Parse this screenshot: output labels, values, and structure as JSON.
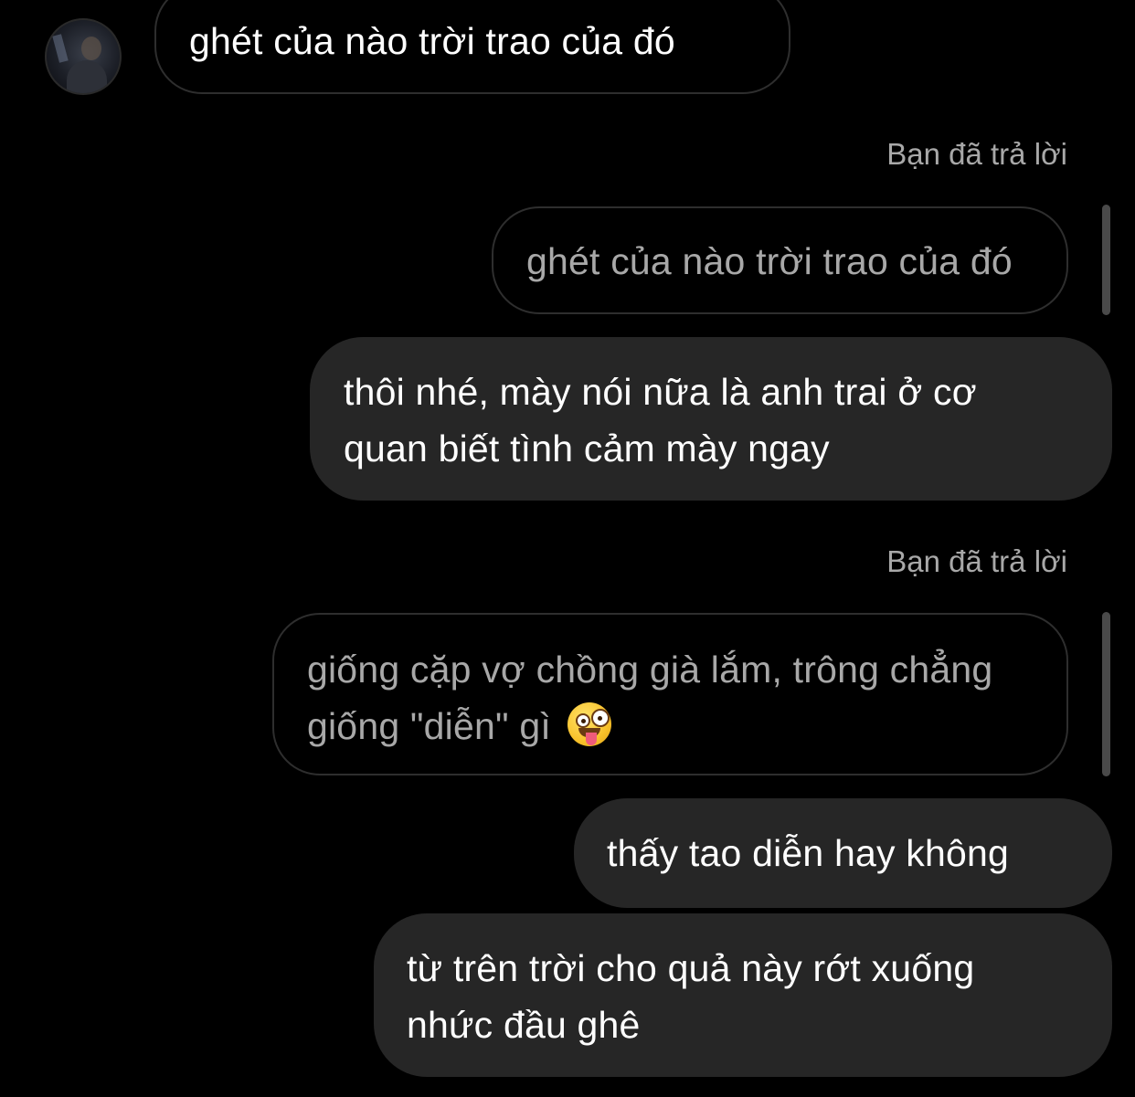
{
  "messages": {
    "incoming_1": "ghét của nào trời trao của đó",
    "reply_label_1": "Bạn đã trả lời",
    "quoted_1": "ghét của nào trời trao của đó",
    "outgoing_1_line1": "thôi nhé, mày nói nữa là anh trai ở cơ",
    "outgoing_1_line2": "quan biết tình cảm mày ngay",
    "reply_label_2": "Bạn đã trả lời",
    "quoted_2_line1": "giống cặp vợ chồng già lắm, trông chẳng",
    "quoted_2_line2": "giống \"diễn\" gì",
    "outgoing_2": "thấy tao diễn hay không",
    "outgoing_3_line1": "từ trên trời cho quả này rớt xuống",
    "outgoing_3_line2": "nhức đầu ghê"
  },
  "icons": {
    "avatar": "contact-avatar-photo",
    "emoji": "zany-face-emoji"
  },
  "colors": {
    "background": "#000000",
    "outgoing_bubble": "#262626",
    "bubble_border": "#2e2e2e",
    "secondary_text": "#a8a8a8",
    "primary_text": "#ffffff"
  }
}
